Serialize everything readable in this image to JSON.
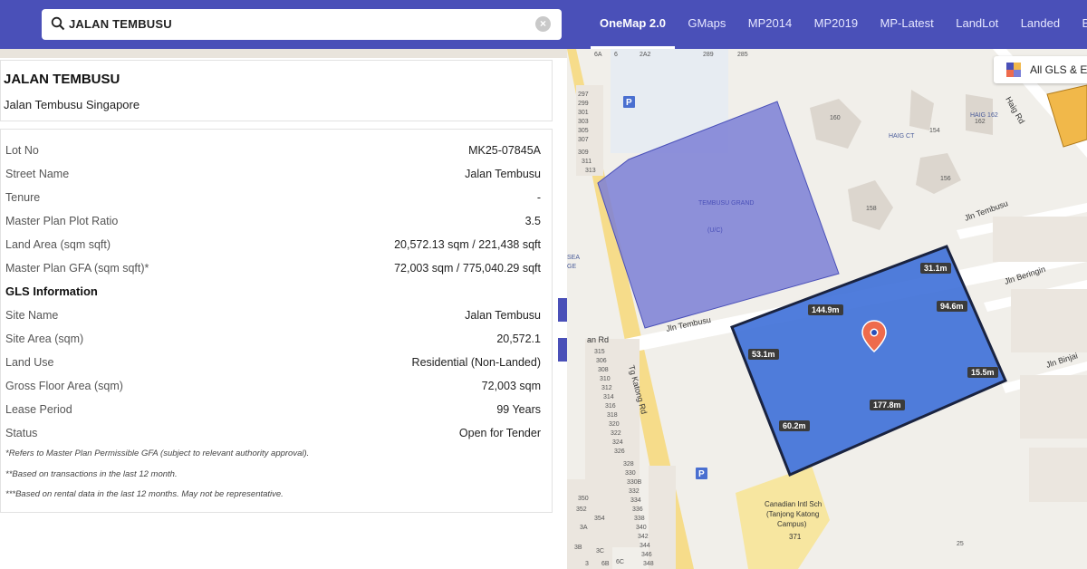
{
  "search": {
    "value": "JALAN TEMBUSU"
  },
  "nav_tabs": [
    "OneMap 2.0",
    "GMaps",
    "MP2014",
    "MP2019",
    "MP-Latest",
    "LandLot",
    "Landed",
    "Building H"
  ],
  "header_card": {
    "title": "JALAN TEMBUSU",
    "subtitle": "Jalan Tembusu Singapore"
  },
  "lot_info": [
    {
      "label": "Lot No",
      "value": "MK25-07845A"
    },
    {
      "label": "Street Name",
      "value": "Jalan Tembusu"
    },
    {
      "label": "Tenure",
      "value": "-"
    },
    {
      "label": "Master Plan Plot Ratio",
      "value": "3.5"
    },
    {
      "label": "Land Area (sqm sqft)",
      "value": "20,572.13 sqm / 221,438 sqft"
    },
    {
      "label": "Master Plan GFA (sqm sqft)*",
      "value": "72,003 sqm / 775,040.29 sqft"
    }
  ],
  "gls_title": "GLS Information",
  "gls_info": [
    {
      "label": "Site Name",
      "value": "Jalan Tembusu"
    },
    {
      "label": "Site Area (sqm)",
      "value": "20,572.1"
    },
    {
      "label": "Land Use",
      "value": "Residential (Non-Landed)"
    },
    {
      "label": "Gross Floor Area (sqm)",
      "value": "72,003 sqm"
    },
    {
      "label": "Lease Period",
      "value": "99 Years"
    },
    {
      "label": "Status",
      "value": "Open for Tender"
    }
  ],
  "notes": [
    "*Refers to Master Plan Permissible GFA (subject to relevant authority approval).",
    "**Based on transactions in the last 12 month.",
    "***Based on rental data in the last 12 months. May not be representative."
  ],
  "collapse_buttons": {
    "expand": "›",
    "collapse": "‹"
  },
  "legend_label": "All GLS & Er",
  "map": {
    "streets": {
      "jln_tembusu": "Jln Tembusu",
      "jln_tembusu_2": "Jln Tembusu",
      "tg_katong": "Tg Katong Rd",
      "haig_rd": "Haig Rd",
      "jln_beringin": "Jln Beringin",
      "jln_binjai": "Jln Binjai",
      "an_rd": "an Rd"
    },
    "places": {
      "tembusu_grand": "TEMBUSU GRAND",
      "tembusu_grand_sub": "(U/C)",
      "haig_ct": "HAIG CT",
      "haig_162": "HAIG 162",
      "school_1": "Canadian Intl Sch",
      "school_2": "(Tanjong Katong",
      "school_3": "Campus)",
      "school_no": "371",
      "sea": "SEA",
      "ge": "GE"
    },
    "measurements": {
      "m1": "144.9m",
      "m2": "31.1m",
      "m3": "94.6m",
      "m4": "53.1m",
      "m5": "15.5m",
      "m6": "177.8m",
      "m7": "60.2m"
    },
    "block_numbers": [
      "160",
      "154",
      "156",
      "158",
      "162",
      "25",
      "6A",
      "6",
      "2A2",
      "289",
      "285",
      "297",
      "299",
      "301",
      "303",
      "305",
      "307",
      "309",
      "311",
      "313",
      "315",
      "306",
      "308",
      "310",
      "312",
      "314",
      "316",
      "318",
      "320",
      "322",
      "324",
      "326",
      "328",
      "330",
      "330B",
      "332",
      "334",
      "336",
      "338",
      "340",
      "342",
      "344",
      "346",
      "348",
      "350",
      "352",
      "354",
      "3A",
      "3B",
      "3C",
      "3",
      "6B",
      "6C",
      "6D",
      "5"
    ],
    "colors": {
      "site_fill": "#3d6fd8",
      "site_border": "#1a2340",
      "tembusu_grand": "#7b7fd6",
      "road_main": "#f6dc8a",
      "school": "#f7e6a0"
    }
  }
}
